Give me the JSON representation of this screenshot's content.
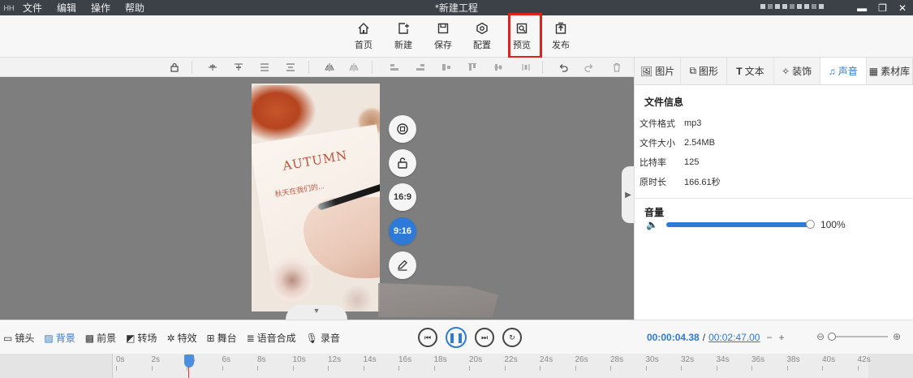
{
  "titlebar": {
    "app_icon": "app-logo-icon",
    "menu": [
      "文件",
      "编辑",
      "操作",
      "帮助"
    ],
    "doc_title": "*新建工程",
    "window_buttons": [
      "minimize-icon",
      "restore-icon",
      "close-icon"
    ]
  },
  "toolbar": {
    "items": [
      {
        "label": "首页",
        "icon": "home-icon"
      },
      {
        "label": "新建",
        "icon": "new-file-icon"
      },
      {
        "label": "保存",
        "icon": "save-icon"
      },
      {
        "label": "配置",
        "icon": "settings-icon"
      },
      {
        "label": "预览",
        "icon": "preview-icon"
      },
      {
        "label": "发布",
        "icon": "publish-icon"
      }
    ],
    "highlight_color": "#e0221e"
  },
  "alignbar": {
    "icons": [
      "lock-icon",
      "align-left-icon",
      "align-top-icon",
      "align-center-icon",
      "align-middle-icon",
      "flip-horizontal-icon",
      "flip-vertical-icon",
      "distribute-left-icon",
      "distribute-right-icon",
      "distribute-center-icon",
      "distribute-top-icon",
      "distribute-bottom-icon",
      "undo-icon",
      "redo-icon",
      "delete-icon"
    ]
  },
  "canvas": {
    "image_text": "AUTUMN",
    "handwriting": "秋天在我们的...",
    "ratio_buttons": [
      {
        "name": "rotate-icon",
        "label": ""
      },
      {
        "name": "unlock-icon",
        "label": ""
      },
      {
        "name": "ratio-16-9",
        "label": "16:9"
      },
      {
        "name": "ratio-9-16",
        "label": "9:16",
        "active": true
      },
      {
        "name": "edit-icon",
        "label": ""
      }
    ]
  },
  "right_panel": {
    "tabs": [
      {
        "label": "图片",
        "icon": "image-icon"
      },
      {
        "label": "图形",
        "icon": "shape-icon"
      },
      {
        "label": "文本",
        "icon": "text-icon"
      },
      {
        "label": "装饰",
        "icon": "decoration-icon"
      },
      {
        "label": "声音",
        "icon": "sound-icon",
        "active": true
      },
      {
        "label": "素材库",
        "icon": "library-icon"
      }
    ],
    "file_info_title": "文件信息",
    "file_info": [
      {
        "key": "文件格式",
        "value": "mp3"
      },
      {
        "key": "文件大小",
        "value": "2.54MB"
      },
      {
        "key": "比特率",
        "value": "125"
      },
      {
        "key": "原时长",
        "value": "166.61秒"
      }
    ],
    "volume_title": "音量",
    "volume_value": 100,
    "volume_label": "100%"
  },
  "timeline": {
    "tools": [
      {
        "label": "镜头",
        "icon": "camera-icon"
      },
      {
        "label": "背景",
        "icon": "background-icon",
        "active": true
      },
      {
        "label": "前景",
        "icon": "foreground-icon"
      },
      {
        "label": "转场",
        "icon": "transition-icon"
      },
      {
        "label": "特效",
        "icon": "effects-icon"
      },
      {
        "label": "舞台",
        "icon": "stage-icon"
      },
      {
        "label": "语音合成",
        "icon": "tts-icon"
      },
      {
        "label": "录音",
        "icon": "microphone-icon"
      }
    ],
    "current_time": "00:00:04.38",
    "separator": "/",
    "total_time": "00:02:47.00",
    "minus": "−",
    "plus": "+",
    "ruler_labels": [
      "0s",
      "2s",
      "4s",
      "6s",
      "8s",
      "10s",
      "12s",
      "14s",
      "16s",
      "18s",
      "20s",
      "22s",
      "24s",
      "26s",
      "28s",
      "30s",
      "32s",
      "34s",
      "36s",
      "38s",
      "40s",
      "42s"
    ],
    "accent": "#2d7ad8"
  }
}
